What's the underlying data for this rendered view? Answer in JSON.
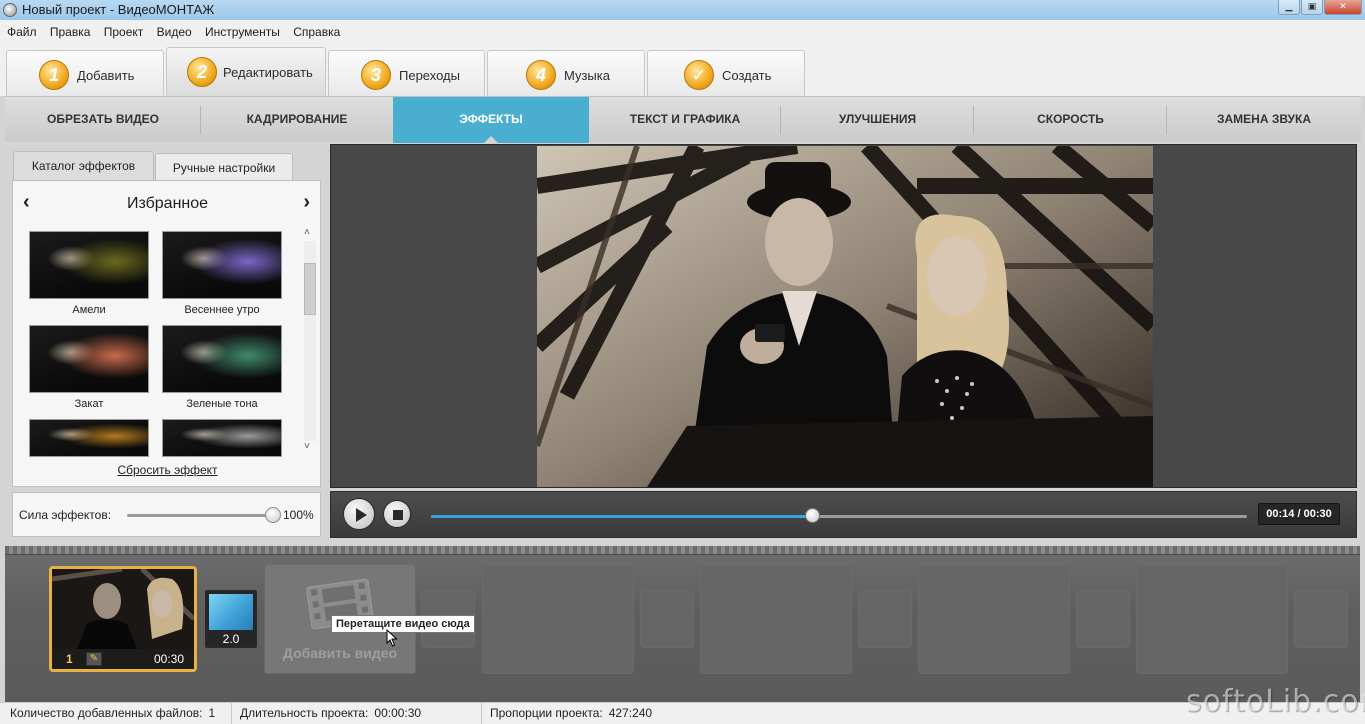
{
  "window": {
    "title": "Новый проект - ВидеоМОНТАЖ",
    "minimize_label": "▁",
    "maximize_label": "▣",
    "close_label": "✕"
  },
  "menu": [
    "Файл",
    "Правка",
    "Проект",
    "Видео",
    "Инструменты",
    "Справка"
  ],
  "steps": [
    {
      "num": "1",
      "label": "Добавить"
    },
    {
      "num": "2",
      "label": "Редактировать"
    },
    {
      "num": "3",
      "label": "Переходы"
    },
    {
      "num": "4",
      "label": "Музыка"
    },
    {
      "num": "✓",
      "label": "Создать"
    }
  ],
  "active_step": 1,
  "edit_tabs": [
    "ОБРЕЗАТЬ ВИДЕО",
    "КАДРИРОВАНИЕ",
    "ЭФФЕКТЫ",
    "ТЕКСТ И ГРАФИКА",
    "УЛУЧШЕНИЯ",
    "СКОРОСТЬ",
    "ЗАМЕНА ЗВУКА"
  ],
  "active_edit_tab": 2,
  "effects_panel": {
    "tabs": [
      "Каталог эффектов",
      "Ручные настройки"
    ],
    "prev_icon": "‹",
    "next_icon": "›",
    "category": "Избранное",
    "effects": [
      {
        "label": "Амели",
        "tint": "#6b6a1e"
      },
      {
        "label": "Весеннее утро",
        "tint": "#7a66c6"
      },
      {
        "label": "Закат",
        "tint": "#c86a4a"
      },
      {
        "label": "Зеленые тона",
        "tint": "#3f8a6c"
      },
      {
        "label": "",
        "tint": "#b07a1e"
      },
      {
        "label": "",
        "tint": "#9a9a9a"
      }
    ],
    "scroll_up": "˄",
    "scroll_down": "˅",
    "reset_link": "Сбросить эффект"
  },
  "strength": {
    "label": "Сила эффектов:",
    "value": "100%",
    "level": 1.0
  },
  "player": {
    "time": "00:14 / 00:30",
    "progress": 0.4667
  },
  "timeline": {
    "clip": {
      "index": "1",
      "duration": "00:30",
      "edit_icon": "✎"
    },
    "transition": {
      "value": "2.0"
    },
    "add_video": "Добавить видео",
    "tooltip": "Перетащите видео сюда"
  },
  "status": {
    "files_label": "Количество добавленных файлов:",
    "files_value": "1",
    "duration_label": "Длительность проекта:",
    "duration_value": "00:00:30",
    "ratio_label": "Пропорции проекта:",
    "ratio_value": "427:240"
  },
  "watermark": "softoLib.com",
  "colors": {
    "accent_tab": "#4aaed0",
    "progress": "#34a5e4",
    "clip_border": "#e6b242"
  }
}
